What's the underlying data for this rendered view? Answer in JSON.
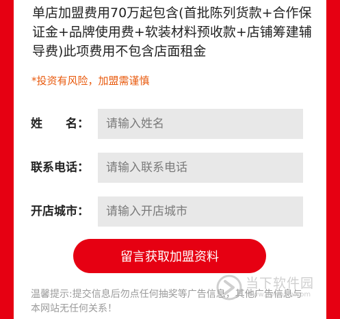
{
  "intro_text": "单店加盟费用70万起包含(首批陈列货款+合作保证金+品牌使用费+软装材料预收款+店铺筹建辅导费)此项费用不包含店面租金",
  "risk_notice": "*投资有风险，加盟需谨慎",
  "form": {
    "fields": [
      {
        "label": "姓　　名：",
        "placeholder": "请输入姓名"
      },
      {
        "label": "联系电话：",
        "placeholder": "请输入联系电话"
      },
      {
        "label": "开店城市：",
        "placeholder": "请输入开店城市"
      }
    ],
    "submit_label": "留言获取加盟资料"
  },
  "tip_text": "温馨提示:提交信息后勿点任何抽奖等广告信息，其他广告信息与本网站无任何关系！",
  "watermark": {
    "name": "当下软件园",
    "url": "www.downxia.com"
  },
  "colors": {
    "brand_red": "#e60012",
    "risk_orange": "#e8590c",
    "input_bg": "#e8e8e8"
  }
}
